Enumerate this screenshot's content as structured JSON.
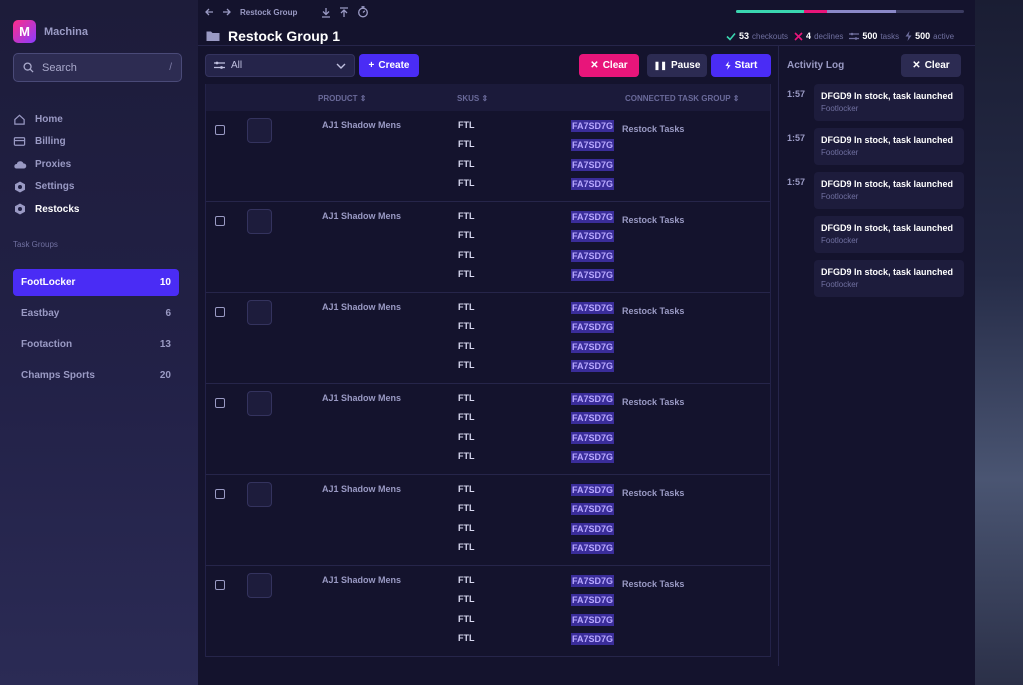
{
  "brand": {
    "logo_letter": "M",
    "name": "Machina"
  },
  "search": {
    "placeholder": "Search",
    "shortcut": "/"
  },
  "nav": [
    {
      "label": "Home",
      "icon": "home-icon"
    },
    {
      "label": "Billing",
      "icon": "card-icon"
    },
    {
      "label": "Proxies",
      "icon": "cloud-icon"
    },
    {
      "label": "Settings",
      "icon": "gear-icon"
    },
    {
      "label": "Restocks",
      "icon": "gear-icon"
    }
  ],
  "section_label": "Task Groups",
  "groups": [
    {
      "name": "FootLocker",
      "count": "10"
    },
    {
      "name": "Eastbay",
      "count": "6"
    },
    {
      "name": "Footaction",
      "count": "13"
    },
    {
      "name": "Champs Sports",
      "count": "20"
    }
  ],
  "breadcrumb": "Restock Group",
  "progress": {
    "teal": 0.3,
    "pink": 0.1,
    "purple": 0.3
  },
  "title": "Restock Group 1",
  "stats": {
    "checkouts_value": "53",
    "checkouts_label": "checkouts",
    "declines_value": "4",
    "declines_label": "declines",
    "tasks_value": "500",
    "tasks_label": "tasks",
    "active_value": "500",
    "active_label": "active"
  },
  "filter": {
    "value": "All"
  },
  "buttons": {
    "create": "Create",
    "clear": "Clear",
    "pause": "Pause",
    "start": "Start"
  },
  "table": {
    "headers": {
      "product": "PRODUCT",
      "skus": "SKUS",
      "group": "CONNECTED TASK GROUP"
    },
    "rows": [
      {
        "product": "AJ1 Shadow Mens",
        "skus": [
          "FTL",
          "FTL",
          "FTL",
          "FTL"
        ],
        "codes": [
          "FA7SD7G",
          "FA7SD7G",
          "FA7SD7G",
          "FA7SD7G"
        ],
        "group": "Restock Tasks"
      },
      {
        "product": "AJ1 Shadow Mens",
        "skus": [
          "FTL",
          "FTL",
          "FTL",
          "FTL"
        ],
        "codes": [
          "FA7SD7G",
          "FA7SD7G",
          "FA7SD7G",
          "FA7SD7G"
        ],
        "group": "Restock Tasks"
      },
      {
        "product": "AJ1 Shadow Mens",
        "skus": [
          "FTL",
          "FTL",
          "FTL",
          "FTL"
        ],
        "codes": [
          "FA7SD7G",
          "FA7SD7G",
          "FA7SD7G",
          "FA7SD7G"
        ],
        "group": "Restock Tasks"
      },
      {
        "product": "AJ1 Shadow Mens",
        "skus": [
          "FTL",
          "FTL",
          "FTL",
          "FTL"
        ],
        "codes": [
          "FA7SD7G",
          "FA7SD7G",
          "FA7SD7G",
          "FA7SD7G"
        ],
        "group": "Restock Tasks"
      },
      {
        "product": "AJ1 Shadow Mens",
        "skus": [
          "FTL",
          "FTL",
          "FTL",
          "FTL"
        ],
        "codes": [
          "FA7SD7G",
          "FA7SD7G",
          "FA7SD7G",
          "FA7SD7G"
        ],
        "group": "Restock Tasks"
      },
      {
        "product": "AJ1 Shadow Mens",
        "skus": [
          "FTL",
          "FTL",
          "FTL",
          "FTL"
        ],
        "codes": [
          "FA7SD7G",
          "FA7SD7G",
          "FA7SD7G",
          "FA7SD7G"
        ],
        "group": "Restock Tasks"
      }
    ]
  },
  "activity": {
    "title": "Activity Log",
    "clear": "Clear",
    "entries": [
      {
        "time": "1:57",
        "msg": "DFGD9 In stock, task launched",
        "sub": "Footlocker"
      },
      {
        "time": "1:57",
        "msg": "DFGD9 In stock, task launched",
        "sub": "Footlocker"
      },
      {
        "time": "1:57",
        "msg": "DFGD9 In stock, task launched",
        "sub": "Footlocker"
      },
      {
        "time": "",
        "msg": "DFGD9 In stock, task launched",
        "sub": "Footlocker"
      },
      {
        "time": "",
        "msg": "DFGD9 In stock, task launched",
        "sub": "Footlocker"
      }
    ]
  },
  "colors": {
    "accent": "#4a2cf5",
    "danger": "#e8157a",
    "success": "#3ad6b0"
  }
}
